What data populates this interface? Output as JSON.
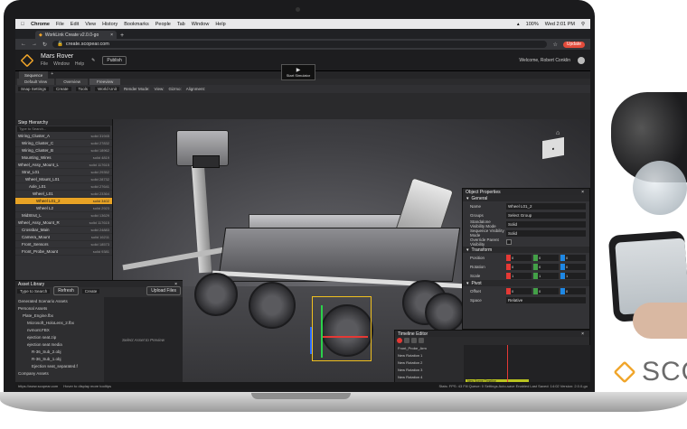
{
  "mac_menubar": {
    "app": "Chrome",
    "menus": [
      "File",
      "Edit",
      "View",
      "History",
      "Bookmarks",
      "People",
      "Tab",
      "Window",
      "Help"
    ],
    "battery": "100%",
    "clock": "Wed 2:01 PM"
  },
  "browser": {
    "tab_title": "WorkLink Create v2.0.0-go",
    "url": "create.scopear.com",
    "update_label": "Update"
  },
  "app": {
    "project_name": "Mars Rover",
    "project_menus": [
      "File",
      "Window",
      "Help"
    ],
    "publish_label": "Publish",
    "start_simulator_label": "Start Simulator",
    "welcome": "Welcome, Robert Conklin"
  },
  "workspace": {
    "tabs": [
      "Sequence"
    ],
    "viewport_tabs": [
      "Default View",
      "Overview",
      "Freeview"
    ],
    "toolbar": [
      "Snap Settings",
      "Create",
      "Tools",
      "World Unit",
      "Render Mode:",
      "View:",
      "Gizmo:",
      "Alignment:"
    ]
  },
  "hierarchy": {
    "title": "Step Hierarchy",
    "search_placeholder": "Type to Search...",
    "items": [
      {
        "label": "Wiring_Cluster_A",
        "status": "solid 31945"
      },
      {
        "label": "Wiring_Cluster_C",
        "status": "solid 27832"
      },
      {
        "label": "Wiring_Cluster_B",
        "status": "solid 18962"
      },
      {
        "label": "Mounting_Wires",
        "status": "solid 4819"
      },
      {
        "label": "Wheel_Assy_Mount_L",
        "status": "solid 117615"
      },
      {
        "label": "Strut_L01",
        "status": "solid 29352"
      },
      {
        "label": "Wheel_Mount_L01",
        "status": "solid 28732"
      },
      {
        "label": "Axle_L01",
        "status": "solid 27641"
      },
      {
        "label": "Wheel_L01",
        "status": "solid 23364"
      },
      {
        "label": "Wheel L01_2",
        "status": "solid 3402",
        "selected": true
      },
      {
        "label": "Wheel L2",
        "status": "solid 2923"
      },
      {
        "label": "MidStrut_L",
        "status": "solid 13629"
      },
      {
        "label": "Wheel_Assy_Mount_R",
        "status": "solid 117615"
      },
      {
        "label": "Crossbar_Main",
        "status": "solid 24883"
      },
      {
        "label": "Camera_Mount",
        "status": "solid 16211"
      },
      {
        "label": "Front_Sensors",
        "status": "solid 18573"
      },
      {
        "label": "Front_Probe_Mount",
        "status": "solid 9381"
      }
    ]
  },
  "asset_library": {
    "title": "Asset Library",
    "refresh_label": "Refresh",
    "create_label": "Create",
    "upload_label": "Upload Files",
    "search_placeholder": "Type to Search",
    "preview_text": "Select Asset to Preview",
    "tree": [
      "Generated Scenario Assets",
      "Personal Assets",
      "Plate_Engine.fbx",
      "Microsoft_HoloLens_2.fbx",
      "nvmont.FBX",
      "ejection seat.zip",
      "ejection seat media",
      "R-36_Sub_2.obj",
      "R-36_Sub_1.obj",
      "Ejection seat_separated.f",
      "Company Assets"
    ]
  },
  "properties": {
    "title": "Object Properties",
    "general": "General",
    "name_label": "Name",
    "name_value": "Wheel L01_2",
    "groups_label": "Groups",
    "groups_value": "Select Group",
    "standalone_label": "Standalone Visibility Mode",
    "standalone_value": "Solid",
    "sequence_label": "Sequence Visibility Mode",
    "sequence_value": "Solid",
    "override_label": "Override Parent Visibility",
    "transform": "Transform",
    "position_label": "Position",
    "rotation_label": "Rotation",
    "scale_label": "Scale",
    "position": [
      "0",
      "0",
      "0"
    ],
    "rotation": [
      "0",
      "0",
      "0"
    ],
    "scale": [
      "1",
      "1",
      "1"
    ],
    "pivot": "Pivot",
    "offset_label": "Offset",
    "offset": [
      "0",
      "0",
      "0"
    ],
    "space_label": "Space",
    "space_value": "Relative"
  },
  "timeline": {
    "title": "Timeline Editor",
    "rows": [
      "Front_Probe_Arm",
      "New Rotation 1",
      "New Rotation 2",
      "New Rotation 3",
      "New Rotation 4",
      "Main_Front_Probe_B"
    ],
    "keyframe_label": "New Scene Timeline"
  },
  "statusbar": {
    "left": "https://www.scopear.com",
    "hint": "Hover to display more tooltips",
    "right": "Stats: FPS: 43  Fill Queue: 0  Settings  Auto-save Enabled  Last Saved: 14:02  Version: 2.0.0-go"
  },
  "brand": {
    "name": "SCO"
  }
}
